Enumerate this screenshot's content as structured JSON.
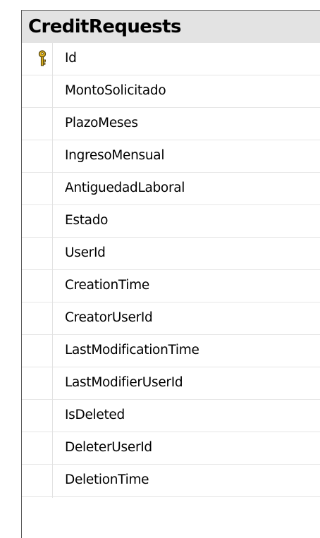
{
  "table": {
    "title": "CreditRequests",
    "columns": [
      {
        "name": "Id",
        "primary_key": true
      },
      {
        "name": "MontoSolicitado",
        "primary_key": false
      },
      {
        "name": "PlazoMeses",
        "primary_key": false
      },
      {
        "name": "IngresoMensual",
        "primary_key": false
      },
      {
        "name": "AntiguedadLaboral",
        "primary_key": false
      },
      {
        "name": "Estado",
        "primary_key": false
      },
      {
        "name": "UserId",
        "primary_key": false
      },
      {
        "name": "CreationTime",
        "primary_key": false
      },
      {
        "name": "CreatorUserId",
        "primary_key": false
      },
      {
        "name": "LastModificationTime",
        "primary_key": false
      },
      {
        "name": "LastModifierUserId",
        "primary_key": false
      },
      {
        "name": "IsDeleted",
        "primary_key": false
      },
      {
        "name": "DeleterUserId",
        "primary_key": false
      },
      {
        "name": "DeletionTime",
        "primary_key": false
      }
    ]
  },
  "icons": {
    "primary_key": "key-icon"
  },
  "colors": {
    "header_bg": "#e3e3e3",
    "key_gold": "#e7b820",
    "key_outline": "#5a4a10",
    "frame": "#5c5c5c"
  }
}
